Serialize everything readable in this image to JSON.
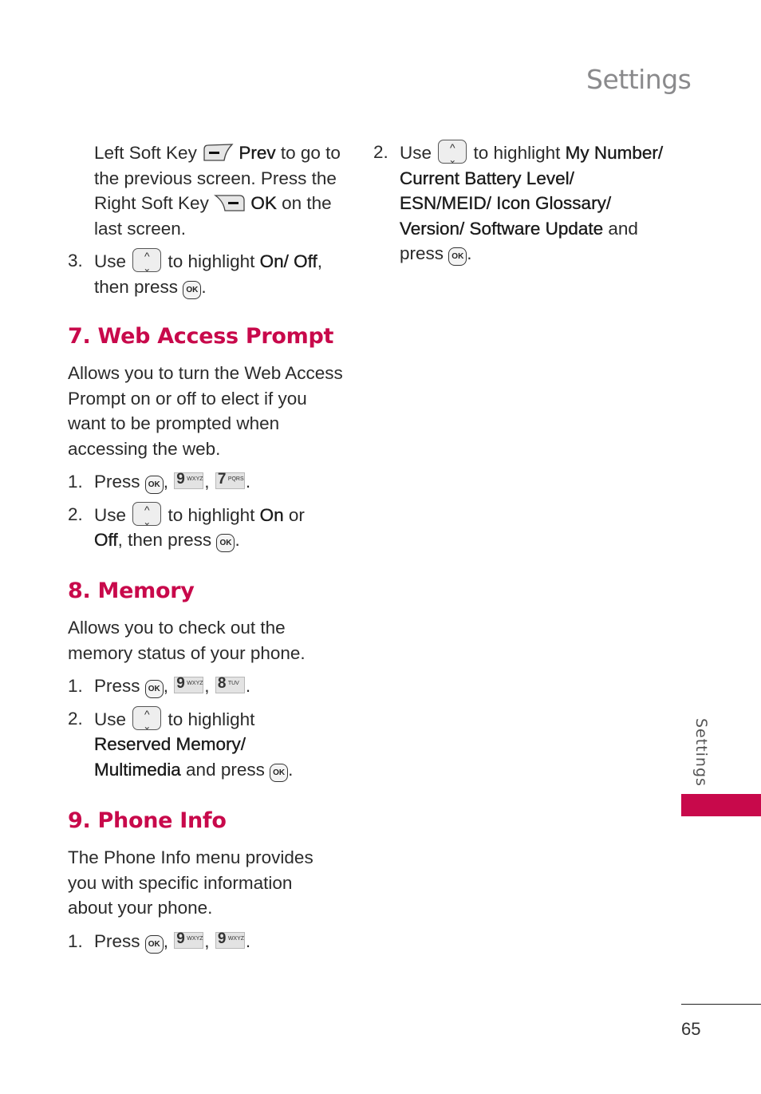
{
  "header": {
    "title": "Settings"
  },
  "left_column": {
    "continuation": {
      "text_1": "Left Soft Key",
      "prev_label": "Prev",
      "text_2": " to go to the previous screen. Press the Right Soft Key",
      "ok_label": "OK",
      "text_3": " on the last screen."
    },
    "step3": {
      "num": "3.",
      "text_1": "Use",
      "text_2": " to highlight ",
      "bold": "On/ Off",
      "text_3": ",",
      "text_4": "then press",
      "text_5": "."
    }
  },
  "sections": [
    {
      "heading": "7. Web Access Prompt",
      "description": "Allows you to turn the Web Access Prompt on or off to elect if you want to be prompted when accessing the web.",
      "steps": [
        {
          "num": "1.",
          "text": "Press",
          "keys": [
            "OK",
            "9 WXYZ",
            "7 PQRS"
          ]
        },
        {
          "num": "2.",
          "text_1": "Use",
          "text_2": " to highlight ",
          "bold_1": "On",
          "text_3": " or ",
          "bold_2": "Off",
          "text_4": ", then press",
          "text_5": "."
        }
      ]
    },
    {
      "heading": "8. Memory",
      "description": "Allows you to check out the memory status of your phone.",
      "steps": [
        {
          "num": "1.",
          "text": "Press",
          "keys": [
            "OK",
            "9 WXYZ",
            "8 TUV"
          ]
        },
        {
          "num": "2.",
          "text_1": "Use",
          "text_2": " to highlight",
          "bold_1": "Reserved Memory/",
          "bold_2": "Multimedia",
          "text_3": " and press",
          "text_4": "."
        }
      ]
    },
    {
      "heading": "9. Phone Info",
      "description": "The Phone Info menu provides you with specific information about your phone.",
      "steps": [
        {
          "num": "1.",
          "text": "Press",
          "keys": [
            "OK",
            "9 WXYZ",
            "9 WXYZ"
          ]
        }
      ]
    }
  ],
  "right_column": {
    "step2": {
      "num": "2.",
      "text_1": "Use",
      "text_2": " to highlight ",
      "bold_1": "My Number/ Current Battery Level/ ESN/MEID/ Icon Glossary/ Version/ Software Update",
      "text_3": " and press",
      "text_4": "."
    }
  },
  "keys": {
    "ok": "OK",
    "nine_digit": "9",
    "nine_letters": "WXYZ",
    "seven_digit": "7",
    "seven_letters": "PQRS",
    "eight_digit": "8",
    "eight_letters": "TUV"
  },
  "sidebar": {
    "tab_label": "Settings",
    "accent_color": "#c8094b"
  },
  "footer": {
    "page_number": "65"
  },
  "colors": {
    "heading": "#c8094b",
    "header_gray": "#8a8a8c",
    "body_text": "#2b2b2b"
  }
}
